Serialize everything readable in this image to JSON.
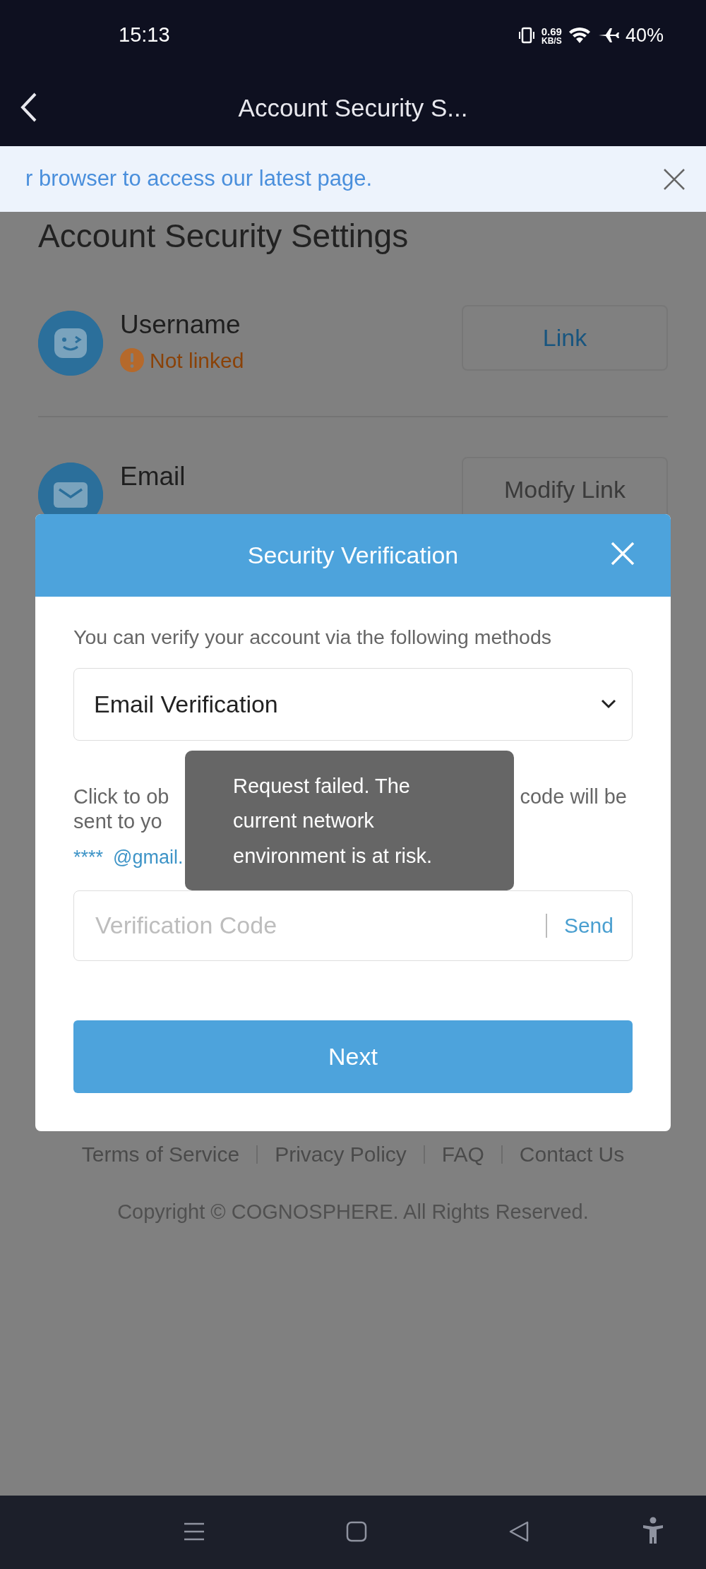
{
  "status_bar": {
    "time": "15:13",
    "speed": "0.69",
    "speed_unit": "KB/S",
    "battery": "40%"
  },
  "header": {
    "title": "Account Security S..."
  },
  "banner": {
    "text": "r browser to access our latest page."
  },
  "page": {
    "heading": "Account Security Settings",
    "accounts": [
      {
        "kind": "username",
        "name": "Username",
        "status": "Not linked",
        "linked": false,
        "button": "Link"
      },
      {
        "kind": "email",
        "name": "Email",
        "linked": true,
        "button": "Modify Link"
      }
    ]
  },
  "footer": {
    "links": [
      "Terms of Service",
      "Privacy Policy",
      "FAQ",
      "Contact Us"
    ],
    "copyright": "Copyright © COGNOSPHERE. All Rights Reserved."
  },
  "modal": {
    "title": "Security Verification",
    "description": "You can verify your account via the following methods",
    "method": "Email Verification",
    "hint_lines": [
      [
        "Click to ob",
        "code will be"
      ],
      [
        "sent to yo"
      ]
    ],
    "email_parts": [
      "****",
      "@gmail."
    ],
    "code_placeholder": "Verification Code",
    "send": "Send",
    "next": "Next"
  },
  "toast": {
    "lines": [
      "Request failed. The",
      "current network",
      "environment is at risk."
    ]
  }
}
